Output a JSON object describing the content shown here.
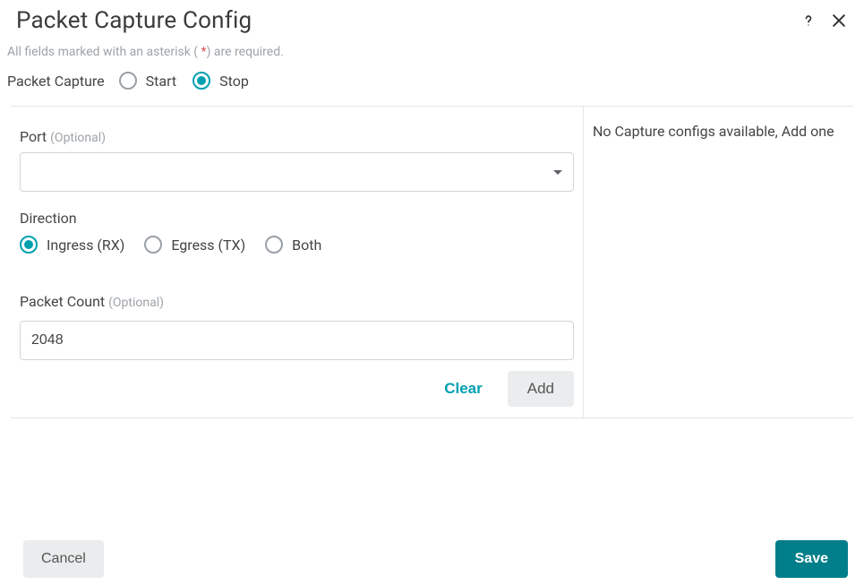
{
  "header": {
    "title": "Packet Capture Config"
  },
  "hint": {
    "prefix": "All fields marked with an asterisk ( ",
    "asterisk": "*",
    "suffix": ") are required."
  },
  "packetCapture": {
    "label": "Packet Capture",
    "options": {
      "start": "Start",
      "stop": "Stop"
    },
    "selected": "stop"
  },
  "form": {
    "port": {
      "label": "Port",
      "optional": "(Optional)",
      "value": ""
    },
    "direction": {
      "label": "Direction",
      "options": {
        "ingress": "Ingress (RX)",
        "egress": "Egress (TX)",
        "both": "Both"
      },
      "selected": "ingress"
    },
    "packetCount": {
      "label": "Packet Count",
      "optional": "(Optional)",
      "value": "2048"
    },
    "actions": {
      "clear": "Clear",
      "add": "Add"
    }
  },
  "rightPanel": {
    "message": "No Capture configs available, Add one"
  },
  "footer": {
    "cancel": "Cancel",
    "save": "Save"
  }
}
